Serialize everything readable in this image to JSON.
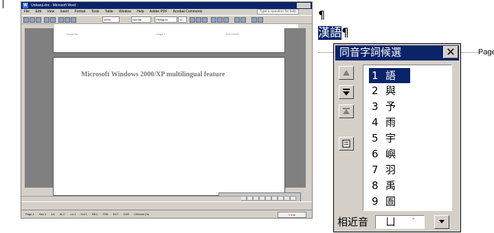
{
  "word_window": {
    "title": "Unikanji.doc - Microsoft Word",
    "menu": [
      "File",
      "Edit",
      "View",
      "Insert",
      "Format",
      "Tools",
      "Table",
      "Window",
      "Help",
      "Adobe PDF",
      "Acrobat Comments"
    ],
    "help_box": "Type a question for help",
    "zoom": "100%",
    "style": "Normal",
    "font": "PMingLiU",
    "size": "12",
    "header_left": "Tuhan Bo",
    "header_center": "Page 1",
    "header_right": "10/17/2003",
    "doc_text": "Microsoft Windows 2000/XP multilingual feature",
    "status": [
      "Page 1",
      "Sec 1",
      "1/1",
      "At 1\"",
      "Ln 1",
      "Col 1",
      "REC",
      "TRK",
      "EXT",
      "OVR",
      "Chinese (Ta"
    ],
    "tray": "1 Ime"
  },
  "editor": {
    "pilcrow": "¶",
    "chars_selected": "漢語",
    "pilcrow_after": "¶",
    "page_label": "Page"
  },
  "ime": {
    "title": "同音字詞候選",
    "close_glyph": "✕",
    "candidates": [
      {
        "num": "1",
        "char": "語"
      },
      {
        "num": "2",
        "char": "與"
      },
      {
        "num": "3",
        "char": "予"
      },
      {
        "num": "4",
        "char": "雨"
      },
      {
        "num": "5",
        "char": "宇"
      },
      {
        "num": "6",
        "char": "嶼"
      },
      {
        "num": "7",
        "char": "羽"
      },
      {
        "num": "8",
        "char": "禹"
      },
      {
        "num": "9",
        "char": "圄"
      }
    ],
    "near_label": "相近音",
    "near_value": "ㄩ",
    "near_chevron": "ˇ"
  }
}
